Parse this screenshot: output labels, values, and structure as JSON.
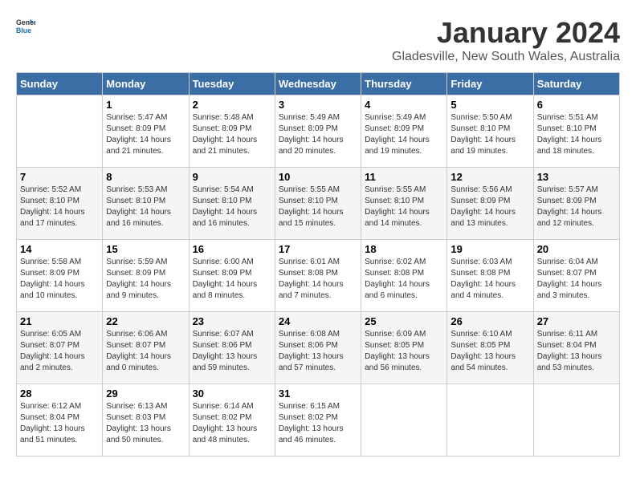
{
  "header": {
    "logo_general": "General",
    "logo_blue": "Blue",
    "month_title": "January 2024",
    "subtitle": "Gladesville, New South Wales, Australia"
  },
  "days_of_week": [
    "Sunday",
    "Monday",
    "Tuesday",
    "Wednesday",
    "Thursday",
    "Friday",
    "Saturday"
  ],
  "weeks": [
    [
      {
        "day": "",
        "info": ""
      },
      {
        "day": "1",
        "info": "Sunrise: 5:47 AM\nSunset: 8:09 PM\nDaylight: 14 hours\nand 21 minutes."
      },
      {
        "day": "2",
        "info": "Sunrise: 5:48 AM\nSunset: 8:09 PM\nDaylight: 14 hours\nand 21 minutes."
      },
      {
        "day": "3",
        "info": "Sunrise: 5:49 AM\nSunset: 8:09 PM\nDaylight: 14 hours\nand 20 minutes."
      },
      {
        "day": "4",
        "info": "Sunrise: 5:49 AM\nSunset: 8:09 PM\nDaylight: 14 hours\nand 19 minutes."
      },
      {
        "day": "5",
        "info": "Sunrise: 5:50 AM\nSunset: 8:10 PM\nDaylight: 14 hours\nand 19 minutes."
      },
      {
        "day": "6",
        "info": "Sunrise: 5:51 AM\nSunset: 8:10 PM\nDaylight: 14 hours\nand 18 minutes."
      }
    ],
    [
      {
        "day": "7",
        "info": "Sunrise: 5:52 AM\nSunset: 8:10 PM\nDaylight: 14 hours\nand 17 minutes."
      },
      {
        "day": "8",
        "info": "Sunrise: 5:53 AM\nSunset: 8:10 PM\nDaylight: 14 hours\nand 16 minutes."
      },
      {
        "day": "9",
        "info": "Sunrise: 5:54 AM\nSunset: 8:10 PM\nDaylight: 14 hours\nand 16 minutes."
      },
      {
        "day": "10",
        "info": "Sunrise: 5:55 AM\nSunset: 8:10 PM\nDaylight: 14 hours\nand 15 minutes."
      },
      {
        "day": "11",
        "info": "Sunrise: 5:55 AM\nSunset: 8:10 PM\nDaylight: 14 hours\nand 14 minutes."
      },
      {
        "day": "12",
        "info": "Sunrise: 5:56 AM\nSunset: 8:09 PM\nDaylight: 14 hours\nand 13 minutes."
      },
      {
        "day": "13",
        "info": "Sunrise: 5:57 AM\nSunset: 8:09 PM\nDaylight: 14 hours\nand 12 minutes."
      }
    ],
    [
      {
        "day": "14",
        "info": "Sunrise: 5:58 AM\nSunset: 8:09 PM\nDaylight: 14 hours\nand 10 minutes."
      },
      {
        "day": "15",
        "info": "Sunrise: 5:59 AM\nSunset: 8:09 PM\nDaylight: 14 hours\nand 9 minutes."
      },
      {
        "day": "16",
        "info": "Sunrise: 6:00 AM\nSunset: 8:09 PM\nDaylight: 14 hours\nand 8 minutes."
      },
      {
        "day": "17",
        "info": "Sunrise: 6:01 AM\nSunset: 8:08 PM\nDaylight: 14 hours\nand 7 minutes."
      },
      {
        "day": "18",
        "info": "Sunrise: 6:02 AM\nSunset: 8:08 PM\nDaylight: 14 hours\nand 6 minutes."
      },
      {
        "day": "19",
        "info": "Sunrise: 6:03 AM\nSunset: 8:08 PM\nDaylight: 14 hours\nand 4 minutes."
      },
      {
        "day": "20",
        "info": "Sunrise: 6:04 AM\nSunset: 8:07 PM\nDaylight: 14 hours\nand 3 minutes."
      }
    ],
    [
      {
        "day": "21",
        "info": "Sunrise: 6:05 AM\nSunset: 8:07 PM\nDaylight: 14 hours\nand 2 minutes."
      },
      {
        "day": "22",
        "info": "Sunrise: 6:06 AM\nSunset: 8:07 PM\nDaylight: 14 hours\nand 0 minutes."
      },
      {
        "day": "23",
        "info": "Sunrise: 6:07 AM\nSunset: 8:06 PM\nDaylight: 13 hours\nand 59 minutes."
      },
      {
        "day": "24",
        "info": "Sunrise: 6:08 AM\nSunset: 8:06 PM\nDaylight: 13 hours\nand 57 minutes."
      },
      {
        "day": "25",
        "info": "Sunrise: 6:09 AM\nSunset: 8:05 PM\nDaylight: 13 hours\nand 56 minutes."
      },
      {
        "day": "26",
        "info": "Sunrise: 6:10 AM\nSunset: 8:05 PM\nDaylight: 13 hours\nand 54 minutes."
      },
      {
        "day": "27",
        "info": "Sunrise: 6:11 AM\nSunset: 8:04 PM\nDaylight: 13 hours\nand 53 minutes."
      }
    ],
    [
      {
        "day": "28",
        "info": "Sunrise: 6:12 AM\nSunset: 8:04 PM\nDaylight: 13 hours\nand 51 minutes."
      },
      {
        "day": "29",
        "info": "Sunrise: 6:13 AM\nSunset: 8:03 PM\nDaylight: 13 hours\nand 50 minutes."
      },
      {
        "day": "30",
        "info": "Sunrise: 6:14 AM\nSunset: 8:02 PM\nDaylight: 13 hours\nand 48 minutes."
      },
      {
        "day": "31",
        "info": "Sunrise: 6:15 AM\nSunset: 8:02 PM\nDaylight: 13 hours\nand 46 minutes."
      },
      {
        "day": "",
        "info": ""
      },
      {
        "day": "",
        "info": ""
      },
      {
        "day": "",
        "info": ""
      }
    ]
  ]
}
